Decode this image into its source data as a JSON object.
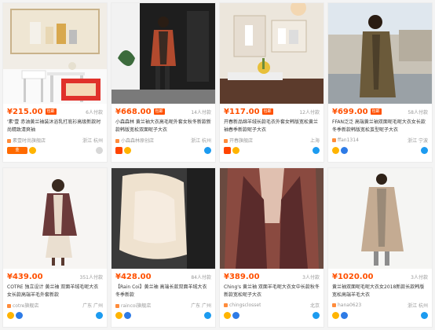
{
  "products": [
    {
      "price": "¥215.00",
      "hot_tag": "包邮",
      "sales": "6人付款",
      "title": "'素'壹 赤油黄兰袖装沐浴乳打底衫高级新款时尚精致清爽袖",
      "shop": "素壹时尚旗舰店",
      "location": "浙江 杭州",
      "badges": [
        "red-wide-badge",
        "crown-badge"
      ],
      "wangwang": "grey"
    },
    {
      "price": "¥668.00",
      "hot_tag": "包邮",
      "sales": "14人付款",
      "title": "小森森林 黄兰袖大衣高毛呢外套女秋冬新款新款韩版宽松双面呢子大衣",
      "shop": "小森森林原创店",
      "location": "浙江 杭州",
      "badges": [
        "red-badge",
        "crown-badge"
      ],
      "wangwang": "blue"
    },
    {
      "price": "¥117.00",
      "hot_tag": "包邮",
      "sales": "12人付款",
      "title": "开春新品绵羊绒长款毛衣外套女韩版宽松黄兰袖春季新款呢子大衣",
      "shop": "开春旗舰店",
      "location": "上海",
      "badges": [
        "crown-badge"
      ],
      "wangwang": "blue"
    },
    {
      "price": "¥699.00",
      "hot_tag": "包邮",
      "sales": "58人付款",
      "title": "FFAN泛泛 高端黄兰袖双面呢毛呢大衣女长款冬季新款韩版宽松茧型呢子大衣",
      "shop": "ffan1314",
      "location": "浙江 宁波",
      "badges": [
        "crown-badge",
        "blue-badge"
      ],
      "wangwang": "blue"
    },
    {
      "price": "¥439.00",
      "hot_tag": "",
      "sales": "351人付款",
      "title": "COTRE 独立设计 黄兰袖 双面羊绒毛呢大衣女长款高端羊毛外套新款",
      "shop": "cotre旗舰店",
      "location": "广东 广州",
      "badges": [
        "crown-badge",
        "blue-badge"
      ],
      "wangwang": "blue"
    },
    {
      "price": "¥428.00",
      "hot_tag": "",
      "sales": "84人付款",
      "title": "【Rain Coi】黄兰袖 高端长款双面羊绒大衣冬季新款",
      "shop": "raincoi旗舰店",
      "location": "广东 广州",
      "badges": [
        "crown-badge",
        "blue-badge"
      ],
      "wangwang": "blue"
    },
    {
      "price": "¥389.00",
      "hot_tag": "",
      "sales": "3人付款",
      "title": "Ching's 黄兰袖 双面羊毛呢大衣女中长款秋冬新款宽松呢子大衣",
      "shop": "chingsclosset",
      "location": "北京",
      "badges": [
        "crown-badge",
        "blue-badge"
      ],
      "wangwang": "blue"
    },
    {
      "price": "¥1020.00",
      "hot_tag": "",
      "sales": "3人付款",
      "title": "黄兰袖双面呢毛呢大衣女2018新款长款韩版宽松高端羊毛大衣",
      "shop": "hana0623",
      "location": "浙江 杭州",
      "badges": [
        "crown-badge",
        "blue-badge"
      ],
      "wangwang": "blue"
    }
  ]
}
